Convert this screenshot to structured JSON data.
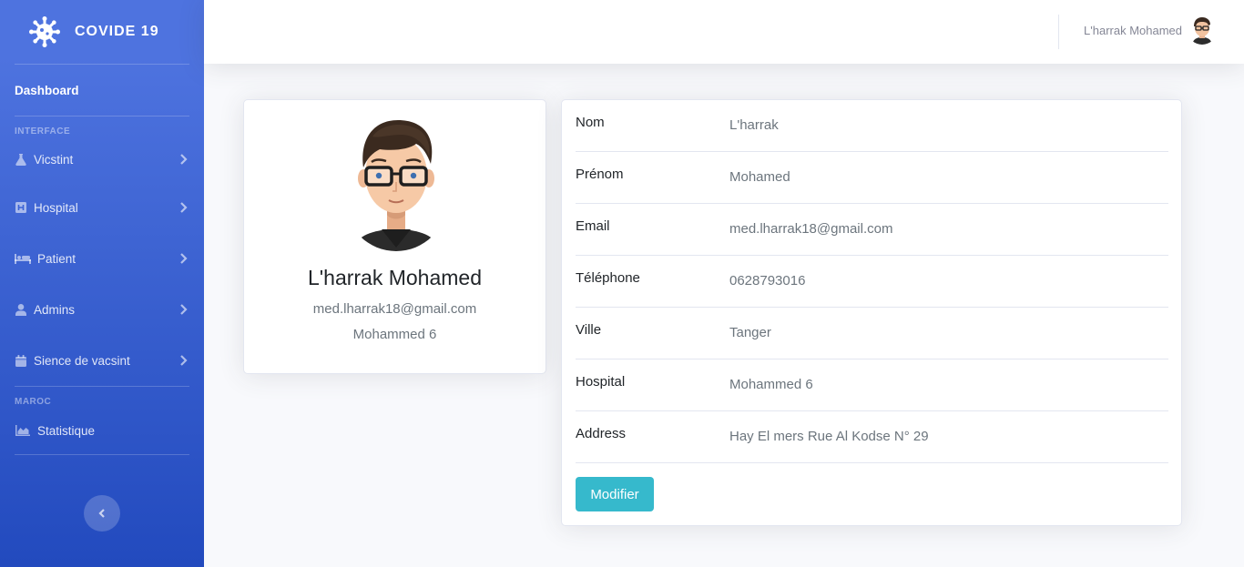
{
  "brand": {
    "name": "COVIDE 19",
    "icon": "virus-icon"
  },
  "sidebar": {
    "dashboard_label": "Dashboard",
    "section_interface": "INTERFACE",
    "items": [
      {
        "label": "Vicstint",
        "icon": "flask-icon"
      },
      {
        "label": "Hospital",
        "icon": "hospital-icon"
      },
      {
        "label": "Patient",
        "icon": "bed-icon"
      },
      {
        "label": "Admins",
        "icon": "user-icon"
      },
      {
        "label": "Sience de vacsint",
        "icon": "calendar-icon"
      }
    ],
    "section_maroc": "MAROC",
    "stat_item": {
      "label": "Statistique",
      "icon": "area-chart-icon"
    }
  },
  "topbar": {
    "user_name": "L'harrak Mohamed"
  },
  "profile": {
    "name": "L'harrak Mohamed",
    "email": "med.lharrak18@gmail.com",
    "hospital": "Mohammed 6"
  },
  "details": {
    "rows": [
      {
        "label": "Nom",
        "value": "L'harrak"
      },
      {
        "label": "Prénom",
        "value": "Mohamed"
      },
      {
        "label": "Email",
        "value": "med.lharrak18@gmail.com"
      },
      {
        "label": "Téléphone",
        "value": "0628793016"
      },
      {
        "label": "Ville",
        "value": "Tanger"
      },
      {
        "label": "Hospital",
        "value": "Mohammed 6"
      },
      {
        "label": "Address",
        "value": "Hay El mers Rue Al Kodse N° 29"
      }
    ],
    "button_label": "Modifier"
  },
  "colors": {
    "sidebar_top": "#4e73df",
    "sidebar_bottom": "#224abe",
    "button": "#36b9cc",
    "background": "#f8f9fc"
  }
}
